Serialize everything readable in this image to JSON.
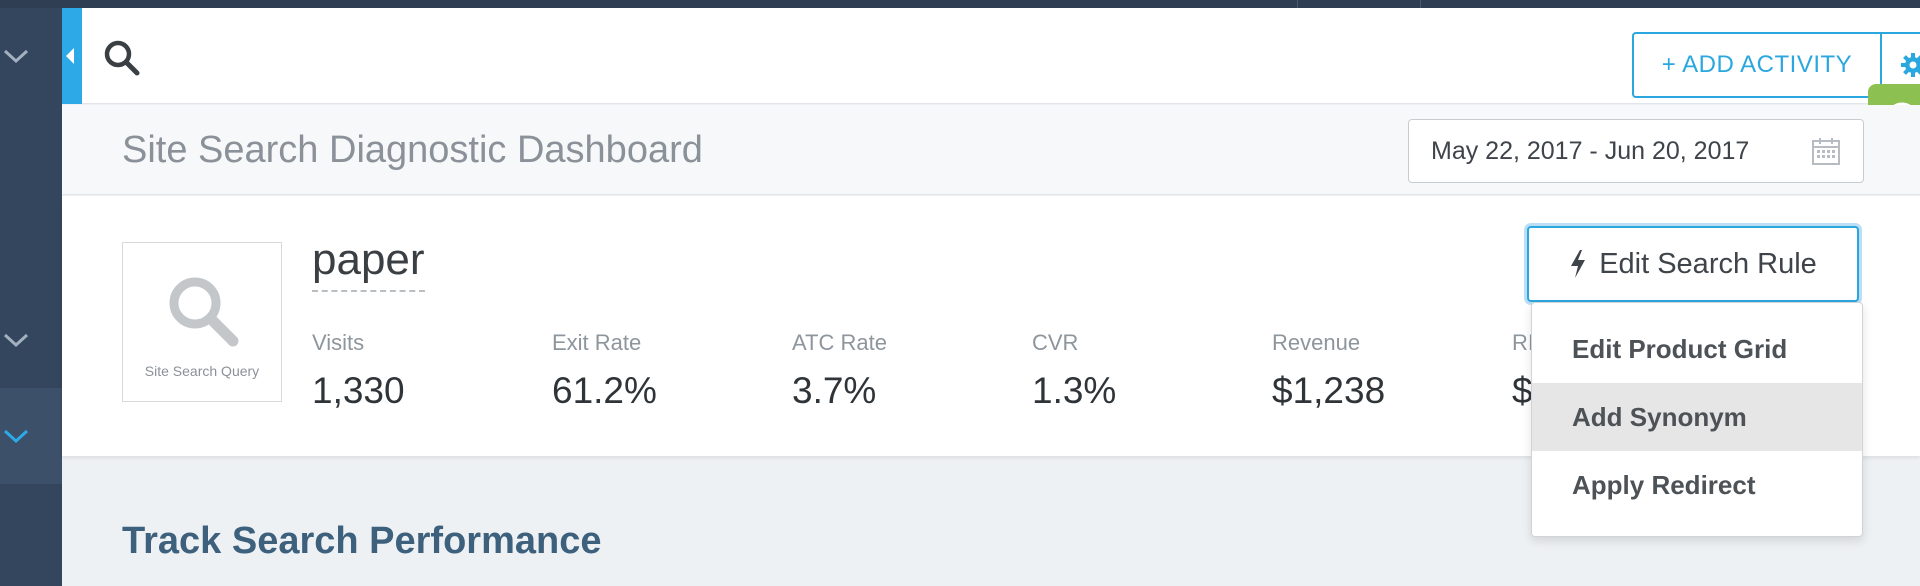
{
  "topbar": {
    "add_activity_label": "+ ADD ACTIVITY"
  },
  "header": {
    "title": "Site Search Diagnostic Dashboard",
    "date_range": "May 22, 2017 - Jun 20, 2017"
  },
  "query": {
    "box_label": "Site Search Query",
    "term": "paper"
  },
  "metrics": [
    {
      "label": "Visits",
      "value": "1,330"
    },
    {
      "label": "Exit Rate",
      "value": "61.2%"
    },
    {
      "label": "ATC Rate",
      "value": "3.7%"
    },
    {
      "label": "CVR",
      "value": "1.3%"
    },
    {
      "label": "Revenue",
      "value": "$1,238"
    },
    {
      "label": "RI",
      "value": "$"
    }
  ],
  "edit_rule": {
    "label": "Edit Search Rule",
    "menu": [
      {
        "label": "Edit Product Grid",
        "highlighted": false
      },
      {
        "label": "Add Synonym",
        "highlighted": true
      },
      {
        "label": "Apply Redirect",
        "highlighted": false
      }
    ]
  },
  "section": {
    "title": "Track Search Performance"
  },
  "colors": {
    "accent": "#2aa7df",
    "sidebar": "#34465d",
    "brand_green": "#8cc152"
  },
  "icons": [
    "search-icon",
    "gear-icon",
    "calendar-icon",
    "magnifier-icon",
    "bolt-icon",
    "chevron-down-icon",
    "collapse-arrow-icon",
    "chameleon-logo-icon"
  ]
}
